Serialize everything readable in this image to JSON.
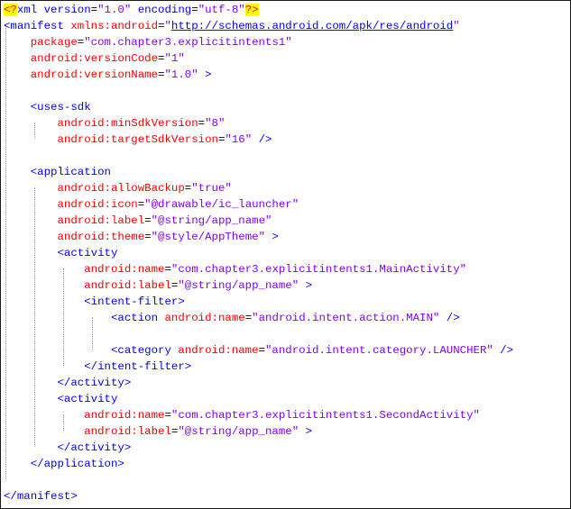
{
  "colors": {
    "tag": "#0000ff",
    "attr": "#ff0000",
    "value": "#8000ff",
    "pi_bg": "#ffff00",
    "pi_fg": "#ff0000",
    "guide": "#9a9a9a"
  },
  "lines": [
    [
      {
        "t": "<?",
        "c": "pi"
      },
      {
        "t": "xml version",
        "c": "t-blue"
      },
      {
        "t": "=",
        "c": "t-black"
      },
      {
        "t": "\"1.0\"",
        "c": "t-purple"
      },
      {
        "t": " encoding",
        "c": "t-blue"
      },
      {
        "t": "=",
        "c": "t-black"
      },
      {
        "t": "\"utf-8\"",
        "c": "t-purple"
      },
      {
        "t": "?>",
        "c": "pi"
      }
    ],
    [
      {
        "t": "<manifest",
        "c": "t-blue"
      },
      {
        "t": " xmlns:android",
        "c": "t-red"
      },
      {
        "t": "=",
        "c": "t-black"
      },
      {
        "t": "\"",
        "c": "t-purple"
      },
      {
        "t": "http://schemas.android.com/apk/res/android",
        "c": "t-link"
      },
      {
        "t": "\"",
        "c": "t-purple"
      }
    ],
    [
      {
        "t": "    package",
        "c": "t-red"
      },
      {
        "t": "=",
        "c": "t-black"
      },
      {
        "t": "\"com.chapter3.explicitintents1\"",
        "c": "t-purple"
      }
    ],
    [
      {
        "t": "    android:versionCode",
        "c": "t-red"
      },
      {
        "t": "=",
        "c": "t-black"
      },
      {
        "t": "\"1\"",
        "c": "t-purple"
      }
    ],
    [
      {
        "t": "    android:versionName",
        "c": "t-red"
      },
      {
        "t": "=",
        "c": "t-black"
      },
      {
        "t": "\"1.0\"",
        "c": "t-purple"
      },
      {
        "t": " >",
        "c": "t-blue"
      }
    ],
    [],
    [
      {
        "t": "    <uses-sdk",
        "c": "t-blue"
      }
    ],
    [
      {
        "t": "        android:minSdkVersion",
        "c": "t-red"
      },
      {
        "t": "=",
        "c": "t-black"
      },
      {
        "t": "\"8\"",
        "c": "t-purple"
      }
    ],
    [
      {
        "t": "        android:targetSdkVersion",
        "c": "t-red"
      },
      {
        "t": "=",
        "c": "t-black"
      },
      {
        "t": "\"16\"",
        "c": "t-purple"
      },
      {
        "t": " />",
        "c": "t-blue"
      }
    ],
    [],
    [
      {
        "t": "    <application",
        "c": "t-blue"
      }
    ],
    [
      {
        "t": "        android:allowBackup",
        "c": "t-red"
      },
      {
        "t": "=",
        "c": "t-black"
      },
      {
        "t": "\"true\"",
        "c": "t-purple"
      }
    ],
    [
      {
        "t": "        android:icon",
        "c": "t-red"
      },
      {
        "t": "=",
        "c": "t-black"
      },
      {
        "t": "\"@drawable/ic_launcher\"",
        "c": "t-purple"
      }
    ],
    [
      {
        "t": "        android:label",
        "c": "t-red"
      },
      {
        "t": "=",
        "c": "t-black"
      },
      {
        "t": "\"@string/app_name\"",
        "c": "t-purple"
      }
    ],
    [
      {
        "t": "        android:theme",
        "c": "t-red"
      },
      {
        "t": "=",
        "c": "t-black"
      },
      {
        "t": "\"@style/AppTheme\"",
        "c": "t-purple"
      },
      {
        "t": " >",
        "c": "t-blue"
      }
    ],
    [
      {
        "t": "        <activity",
        "c": "t-blue"
      }
    ],
    [
      {
        "t": "            android:name",
        "c": "t-red"
      },
      {
        "t": "=",
        "c": "t-black"
      },
      {
        "t": "\"com.chapter3.explicitintents1.MainActivity\"",
        "c": "t-purple"
      }
    ],
    [
      {
        "t": "            android:label",
        "c": "t-red"
      },
      {
        "t": "=",
        "c": "t-black"
      },
      {
        "t": "\"@string/app_name\"",
        "c": "t-purple"
      },
      {
        "t": " >",
        "c": "t-blue"
      }
    ],
    [
      {
        "t": "            <intent-filter>",
        "c": "t-blue"
      }
    ],
    [
      {
        "t": "                <action",
        "c": "t-blue"
      },
      {
        "t": " android:name",
        "c": "t-red"
      },
      {
        "t": "=",
        "c": "t-black"
      },
      {
        "t": "\"android.intent.action.MAIN\"",
        "c": "t-purple"
      },
      {
        "t": " />",
        "c": "t-blue"
      }
    ],
    [],
    [
      {
        "t": "                <category",
        "c": "t-blue"
      },
      {
        "t": " android:name",
        "c": "t-red"
      },
      {
        "t": "=",
        "c": "t-black"
      },
      {
        "t": "\"android.intent.category.LAUNCHER\"",
        "c": "t-purple"
      },
      {
        "t": " />",
        "c": "t-blue"
      }
    ],
    [
      {
        "t": "            </intent-filter>",
        "c": "t-blue"
      }
    ],
    [
      {
        "t": "        </activity>",
        "c": "t-blue"
      }
    ],
    [
      {
        "t": "        <activity",
        "c": "t-blue"
      }
    ],
    [
      {
        "t": "            android:name",
        "c": "t-red"
      },
      {
        "t": "=",
        "c": "t-black"
      },
      {
        "t": "\"com.chapter3.explicitintents1.SecondActivity\"",
        "c": "t-purple"
      }
    ],
    [
      {
        "t": "            android:label",
        "c": "t-red"
      },
      {
        "t": "=",
        "c": "t-black"
      },
      {
        "t": "\"@string/app_name\"",
        "c": "t-purple"
      },
      {
        "t": " >",
        "c": "t-blue"
      }
    ],
    [
      {
        "t": "        </activity>",
        "c": "t-blue"
      }
    ],
    [
      {
        "t": "    </application>",
        "c": "t-blue"
      }
    ],
    [],
    [
      {
        "t": "</manifest>",
        "c": "t-blue"
      }
    ]
  ]
}
